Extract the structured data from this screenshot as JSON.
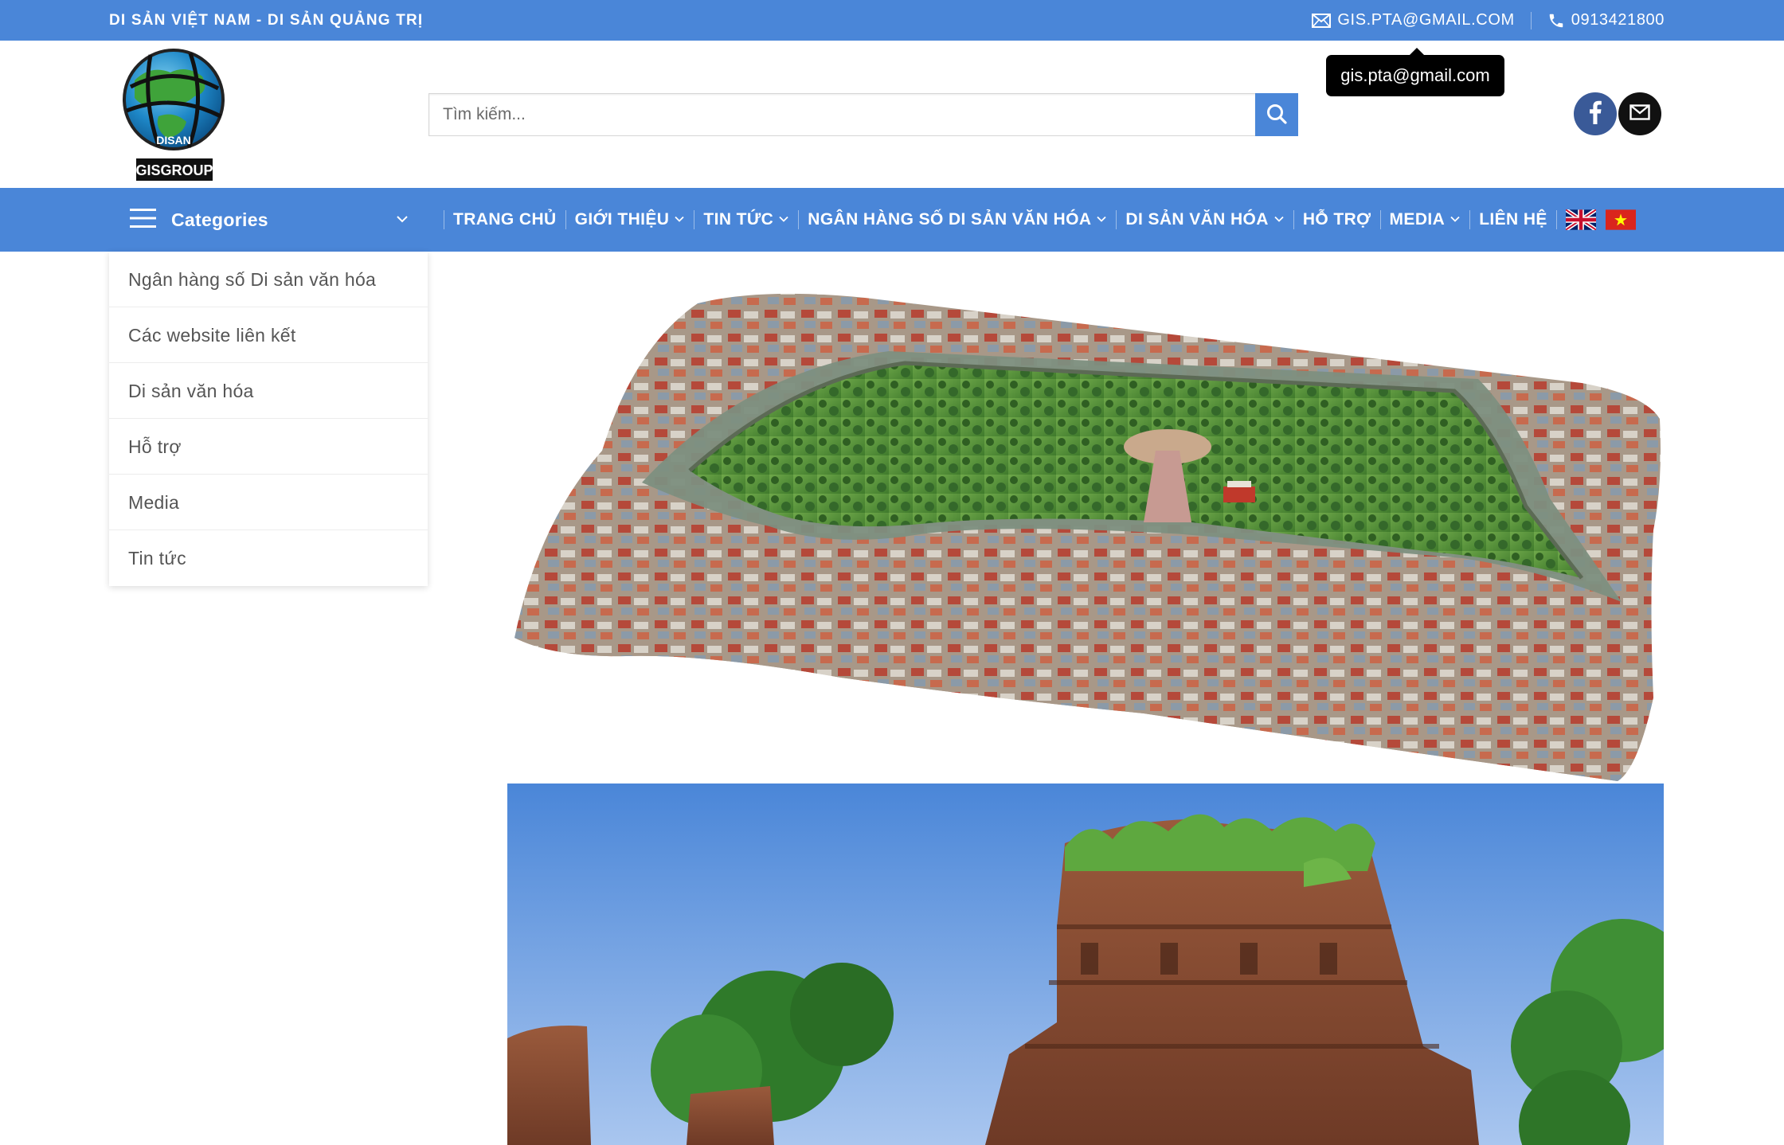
{
  "topbar": {
    "tagline": "DI SẢN VIỆT NAM - DI SẢN QUẢNG TRỊ",
    "email_label": "GIS.PTA@GMAIL.COM",
    "phone_label": "0913421800",
    "email_icon": "envelope-icon",
    "phone_icon": "phone-icon"
  },
  "tooltip": {
    "text": "gis.pta@gmail.com"
  },
  "logo": {
    "name": "GISGROUP",
    "ring_text": "DISAN"
  },
  "search": {
    "placeholder": "Tìm kiếm...",
    "value": ""
  },
  "social": {
    "facebook_icon": "facebook-icon",
    "email_icon": "envelope-icon"
  },
  "categories": {
    "label": "Categories",
    "items": [
      "Ngân hàng số Di sản văn hóa",
      "Các website liên kết",
      "Di sản văn hóa",
      "Hỗ trợ",
      "Media",
      "Tin tức"
    ]
  },
  "nav": {
    "items": [
      {
        "label": "TRANG CHỦ",
        "dropdown": false
      },
      {
        "label": "GIỚI THIỆU",
        "dropdown": true
      },
      {
        "label": "TIN TỨC",
        "dropdown": true
      },
      {
        "label": "NGÂN HÀNG SỐ DI SẢN VĂN HÓA",
        "dropdown": true
      },
      {
        "label": "DI SẢN VĂN HÓA",
        "dropdown": true
      },
      {
        "label": "HỖ TRỢ",
        "dropdown": false
      },
      {
        "label": "MEDIA",
        "dropdown": true
      },
      {
        "label": "LIÊN HỆ",
        "dropdown": false
      }
    ],
    "languages": [
      "English",
      "Tiếng Việt"
    ]
  },
  "colors": {
    "brand_blue": "#4a86d8",
    "facebook": "#3a5a98",
    "tooltip_bg": "#000000"
  }
}
